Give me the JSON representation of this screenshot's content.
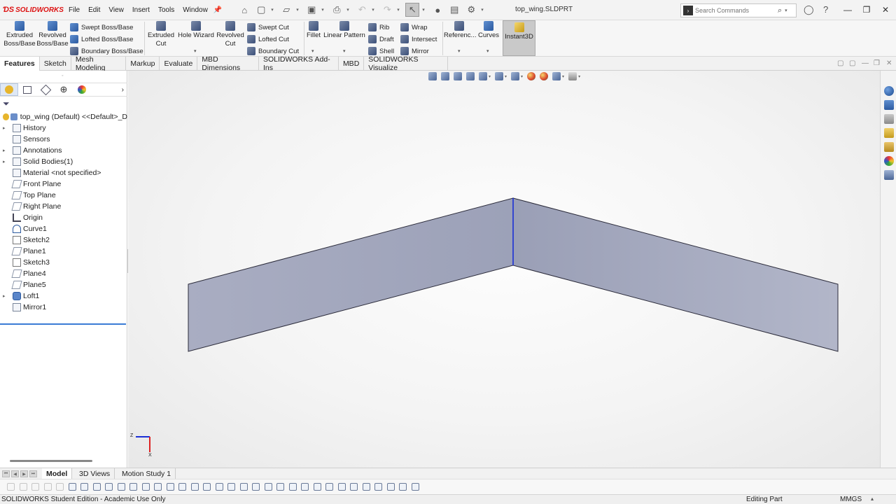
{
  "app": {
    "logo_text": "SOLIDWORKS",
    "document_title": "top_wing.SLDPRT"
  },
  "menu": [
    "File",
    "Edit",
    "View",
    "Insert",
    "Tools",
    "Window"
  ],
  "search": {
    "placeholder": "Search Commands"
  },
  "command_manager": {
    "extruded_boss": "Extruded Boss/Base",
    "revolved_boss": "Revolved Boss/Base",
    "swept_boss": "Swept Boss/Base",
    "lofted_boss": "Lofted Boss/Base",
    "boundary_boss": "Boundary Boss/Base",
    "extruded_cut": "Extruded Cut",
    "hole_wizard": "Hole Wizard",
    "revolved_cut": "Revolved Cut",
    "swept_cut": "Swept Cut",
    "lofted_cut": "Lofted Cut",
    "boundary_cut": "Boundary Cut",
    "fillet": "Fillet",
    "linear_pattern": "Linear Pattern",
    "rib": "Rib",
    "draft": "Draft",
    "shell": "Shell",
    "wrap": "Wrap",
    "intersect": "Intersect",
    "mirror": "Mirror",
    "reference": "Referenc...",
    "curves": "Curves",
    "instant3d": "Instant3D"
  },
  "tabs": [
    "Features",
    "Sketch",
    "Mesh Modeling",
    "Markup",
    "Evaluate",
    "MBD Dimensions",
    "SOLIDWORKS Add-Ins",
    "MBD",
    "SOLIDWORKS Visualize"
  ],
  "active_tab": "Features",
  "feature_tree": {
    "root": "top_wing (Default) <<Default>_D",
    "items": [
      {
        "label": "History",
        "expandable": true,
        "icon": "history-icon"
      },
      {
        "label": "Sensors",
        "expandable": false,
        "icon": "sensors-icon"
      },
      {
        "label": "Annotations",
        "expandable": true,
        "icon": "annotations-icon"
      },
      {
        "label": "Solid Bodies(1)",
        "expandable": true,
        "icon": "solid-bodies-icon"
      },
      {
        "label": "Material <not specified>",
        "expandable": false,
        "icon": "material-icon"
      },
      {
        "label": "Front Plane",
        "expandable": false,
        "icon": "plane-icon"
      },
      {
        "label": "Top Plane",
        "expandable": false,
        "icon": "plane-icon"
      },
      {
        "label": "Right Plane",
        "expandable": false,
        "icon": "plane-icon"
      },
      {
        "label": "Origin",
        "expandable": false,
        "icon": "origin-icon"
      },
      {
        "label": "Curve1",
        "expandable": false,
        "icon": "curve-icon"
      },
      {
        "label": "Sketch2",
        "expandable": false,
        "icon": "sketch-icon"
      },
      {
        "label": "Plane1",
        "expandable": false,
        "icon": "plane-icon"
      },
      {
        "label": "Sketch3",
        "expandable": false,
        "icon": "sketch-icon"
      },
      {
        "label": "Plane4",
        "expandable": false,
        "icon": "plane-icon"
      },
      {
        "label": "Plane5",
        "expandable": false,
        "icon": "plane-icon"
      },
      {
        "label": "Loft1",
        "expandable": true,
        "icon": "loft-icon"
      },
      {
        "label": "Mirror1",
        "expandable": false,
        "icon": "mirror-icon"
      }
    ]
  },
  "bottom_tabs": [
    "Model",
    "3D Views",
    "Motion Study 1"
  ],
  "active_bottom_tab": "Model",
  "status": {
    "edition": "SOLIDWORKS Student Edition - Academic Use Only",
    "mode": "Editing Part",
    "units": "MMGS"
  },
  "triad": {
    "x_axis": "X",
    "z_axis": "Z"
  },
  "colors": {
    "wing_face": "#a3a7bd",
    "accent_blue": "#3a7bd5",
    "logo_red": "#d11111"
  }
}
